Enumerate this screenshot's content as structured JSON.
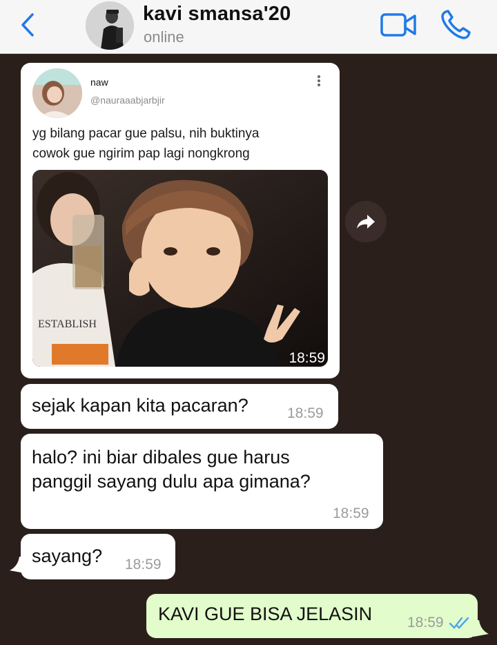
{
  "header": {
    "contact_name": "kavi smansa'20",
    "status": "online",
    "accent_color": "#1f7ae8"
  },
  "tweet": {
    "name": "naw",
    "handle": "@nauraaabjarbjir",
    "text_line1": "yg bilang pacar gue palsu, nih buktinya",
    "text_line2": "cowok gue ngirim pap lagi nongkrong",
    "photo_shirt_text": "ESTABLISH",
    "photo_time": "18:59"
  },
  "messages": [
    {
      "direction": "in",
      "line1": "sejak kapan kita pacaran?",
      "line2": "",
      "time": "18:59"
    },
    {
      "direction": "in",
      "line1": "halo? ini biar dibales gue harus",
      "line2": "panggil sayang dulu apa gimana?",
      "time": "18:59"
    },
    {
      "direction": "in",
      "line1": "sayang?",
      "line2": "",
      "time": "18:59"
    },
    {
      "direction": "out",
      "line1": "KAVI GUE BISA JELASIN",
      "line2": "",
      "time": "18:59",
      "read": true
    }
  ],
  "colors": {
    "chat_background": "#2b1f1c",
    "incoming_bubble": "#ffffff",
    "outgoing_bubble": "#e2fccb",
    "read_ticks": "#4fa8e8"
  }
}
